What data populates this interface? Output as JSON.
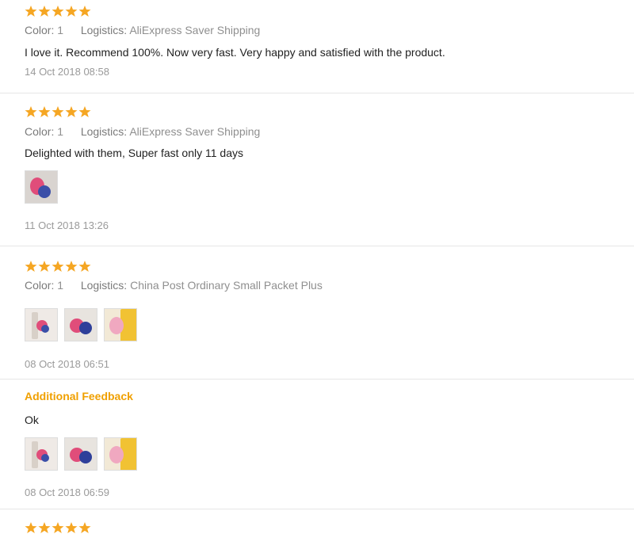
{
  "colors": {
    "star": "#f5a623",
    "accent": "#f0a000"
  },
  "labels": {
    "color": "Color:",
    "logistics": "Logistics:"
  },
  "reviews": [
    {
      "rating": 5,
      "color_value": "1",
      "logistics_value": "AliExpress Saver Shipping",
      "text": "I love it. Recommend 100%. Now very fast. Very happy and satisfied with the product.",
      "date": "14 Oct 2018 08:58"
    },
    {
      "rating": 5,
      "color_value": "1",
      "logistics_value": "AliExpress Saver Shipping",
      "text": "Delighted with them, Super fast only 11 days",
      "date": "11 Oct 2018 13:26",
      "photos": 1
    },
    {
      "rating": 5,
      "color_value": "1",
      "logistics_value": "China Post Ordinary Small Packet Plus",
      "date": "08 Oct 2018 06:51",
      "photos": 3,
      "additional_feedback": {
        "label": "Additional Feedback",
        "text": "Ok",
        "date": "08 Oct 2018 06:59",
        "photos": 3
      }
    },
    {
      "rating": 5
    }
  ]
}
